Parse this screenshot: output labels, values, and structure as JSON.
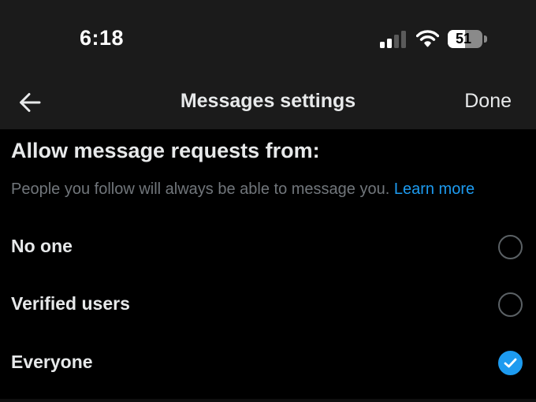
{
  "status_bar": {
    "time": "6:18",
    "battery_percent": "51",
    "battery_level": 0.51,
    "signal_bars_active": 2,
    "signal_bars_total": 4,
    "icons": [
      "signal-icon",
      "wifi-icon",
      "battery-icon"
    ]
  },
  "nav": {
    "back_icon": "arrow-left-icon",
    "title": "Messages settings",
    "done_label": "Done"
  },
  "section": {
    "heading": "Allow message requests from:",
    "description": "People you follow will always be able to message you.",
    "learn_more": "Learn more"
  },
  "options": [
    {
      "label": "No one",
      "selected": false
    },
    {
      "label": "Verified users",
      "selected": false
    },
    {
      "label": "Everyone",
      "selected": true
    }
  ],
  "colors": {
    "background": "#000000",
    "header_background": "#1b1b1b",
    "accent": "#1d9bf0",
    "muted_text": "#71767b",
    "primary_text": "#e7e9ea"
  }
}
